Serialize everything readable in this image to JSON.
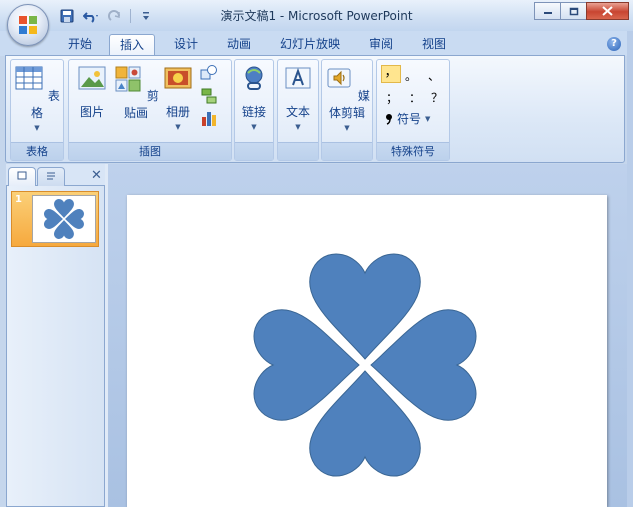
{
  "window": {
    "title": "演示文稿1 - Microsoft PowerPoint",
    "minimize_label": "",
    "maximize_label": "",
    "close_label": ""
  },
  "qat": {
    "icons": [
      "save-icon",
      "undo-icon",
      "redo-icon",
      "customize-icon"
    ]
  },
  "tabs": [
    {
      "label": "开始"
    },
    {
      "label": "插入",
      "active": true
    },
    {
      "label": "设计"
    },
    {
      "label": "动画"
    },
    {
      "label": "幻灯片放映"
    },
    {
      "label": "审阅"
    },
    {
      "label": "视图"
    }
  ],
  "ribbon": {
    "table_group": {
      "label": "表格",
      "button": "表格"
    },
    "illustrations_group": {
      "label": "插图",
      "picture": "图片",
      "clipart": "剪贴画",
      "album": "相册"
    },
    "link_group": {
      "button": "链接"
    },
    "text_group": {
      "button": "文本"
    },
    "media_group": {
      "button": "媒体剪辑"
    },
    "symbols_group": {
      "label": "特殊符号",
      "button": "符号",
      "row1": [
        "，",
        "。",
        "、"
      ],
      "row2": [
        "；",
        "：",
        "？"
      ]
    }
  },
  "slides_pane": {
    "slide_number": "1",
    "close_glyph": "✕"
  },
  "colors": {
    "heart_fill": "#4f81bd",
    "heart_stroke": "#3a6694",
    "slide_bg": "#ffffff",
    "accent_orange": "#f6a93e"
  }
}
